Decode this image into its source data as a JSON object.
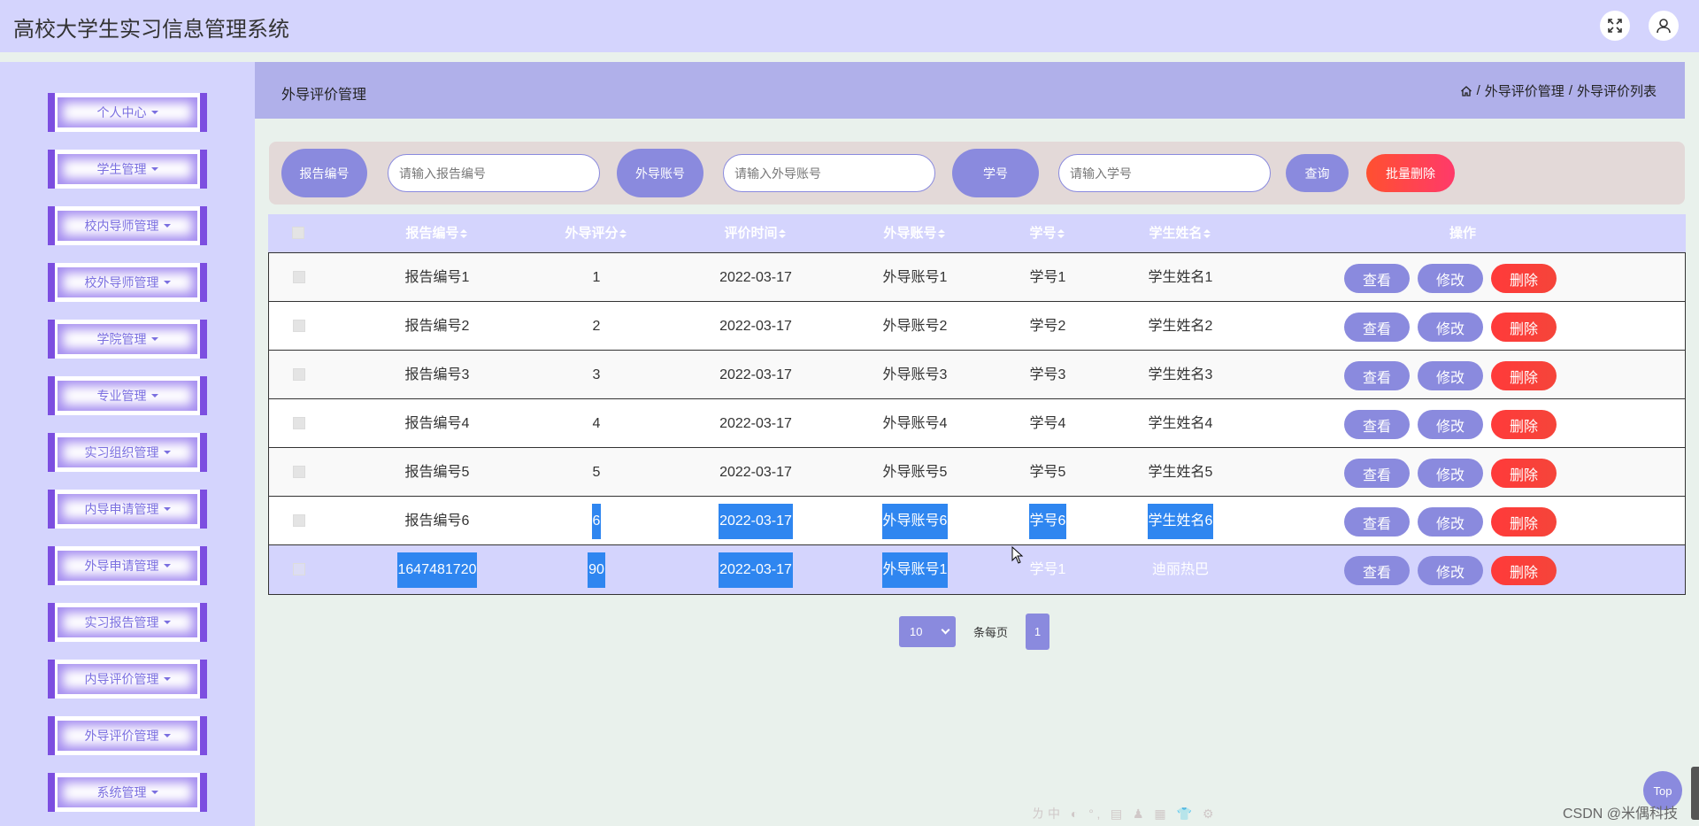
{
  "app": {
    "title": "高校大学生实习信息管理系统"
  },
  "sidebar": {
    "items": [
      {
        "label": "个人中心"
      },
      {
        "label": "学生管理"
      },
      {
        "label": "校内导师管理"
      },
      {
        "label": "校外导师管理"
      },
      {
        "label": "学院管理"
      },
      {
        "label": "专业管理"
      },
      {
        "label": "实习组织管理"
      },
      {
        "label": "内导申请管理"
      },
      {
        "label": "外导申请管理"
      },
      {
        "label": "实习报告管理"
      },
      {
        "label": "内导评价管理"
      },
      {
        "label": "外导评价管理"
      },
      {
        "label": "系统管理"
      }
    ]
  },
  "page": {
    "title": "外导评价管理",
    "breadcrumb": [
      "外导评价管理",
      "外导评价列表"
    ]
  },
  "search": {
    "report_label": "报告编号",
    "report_placeholder": "请输入报告编号",
    "account_label": "外导账号",
    "account_placeholder": "请输入外导账号",
    "student_no_label": "学号",
    "student_no_placeholder": "请输入学号",
    "query_label": "查询",
    "batch_delete_label": "批量删除"
  },
  "table": {
    "headers": [
      "报告编号",
      "外导评分",
      "评价时间",
      "外导账号",
      "学号",
      "学生姓名",
      "操作"
    ],
    "rows": [
      {
        "report_no": "报告编号1",
        "score": "1",
        "time": "2022-03-17",
        "account": "外导账号1",
        "student_no": "学号1",
        "student_name": "学生姓名1"
      },
      {
        "report_no": "报告编号2",
        "score": "2",
        "time": "2022-03-17",
        "account": "外导账号2",
        "student_no": "学号2",
        "student_name": "学生姓名2"
      },
      {
        "report_no": "报告编号3",
        "score": "3",
        "time": "2022-03-17",
        "account": "外导账号3",
        "student_no": "学号3",
        "student_name": "学生姓名3"
      },
      {
        "report_no": "报告编号4",
        "score": "4",
        "time": "2022-03-17",
        "account": "外导账号4",
        "student_no": "学号4",
        "student_name": "学生姓名4"
      },
      {
        "report_no": "报告编号5",
        "score": "5",
        "time": "2022-03-17",
        "account": "外导账号5",
        "student_no": "学号5",
        "student_name": "学生姓名5"
      },
      {
        "report_no": "报告编号6",
        "score": "6",
        "time": "2022-03-17",
        "account": "外导账号6",
        "student_no": "学号6",
        "student_name": "学生姓名6"
      },
      {
        "report_no": "1647481720",
        "score": "90",
        "time": "2022-03-17",
        "account": "外导账号1",
        "student_no": "学号1",
        "student_name": "迪丽热巴"
      }
    ],
    "actions": {
      "view": "查看",
      "edit": "修改",
      "delete": "删除"
    }
  },
  "pager": {
    "page_size": "10",
    "per_page_label": "条每页",
    "current_page": "1"
  },
  "misc": {
    "top_label": "Top",
    "watermark": "CSDN @米偶科技",
    "ime": "ㄌ中 ◐ °‚ ▤ ♟ ▦ 👕 ⚙"
  },
  "colors": {
    "header_bg": "#d4d4fd",
    "accent": "#8a8ade",
    "danger": "#ff3a3a",
    "selection": "#2f86f0",
    "sidebar_border": "#7c4ee0"
  }
}
